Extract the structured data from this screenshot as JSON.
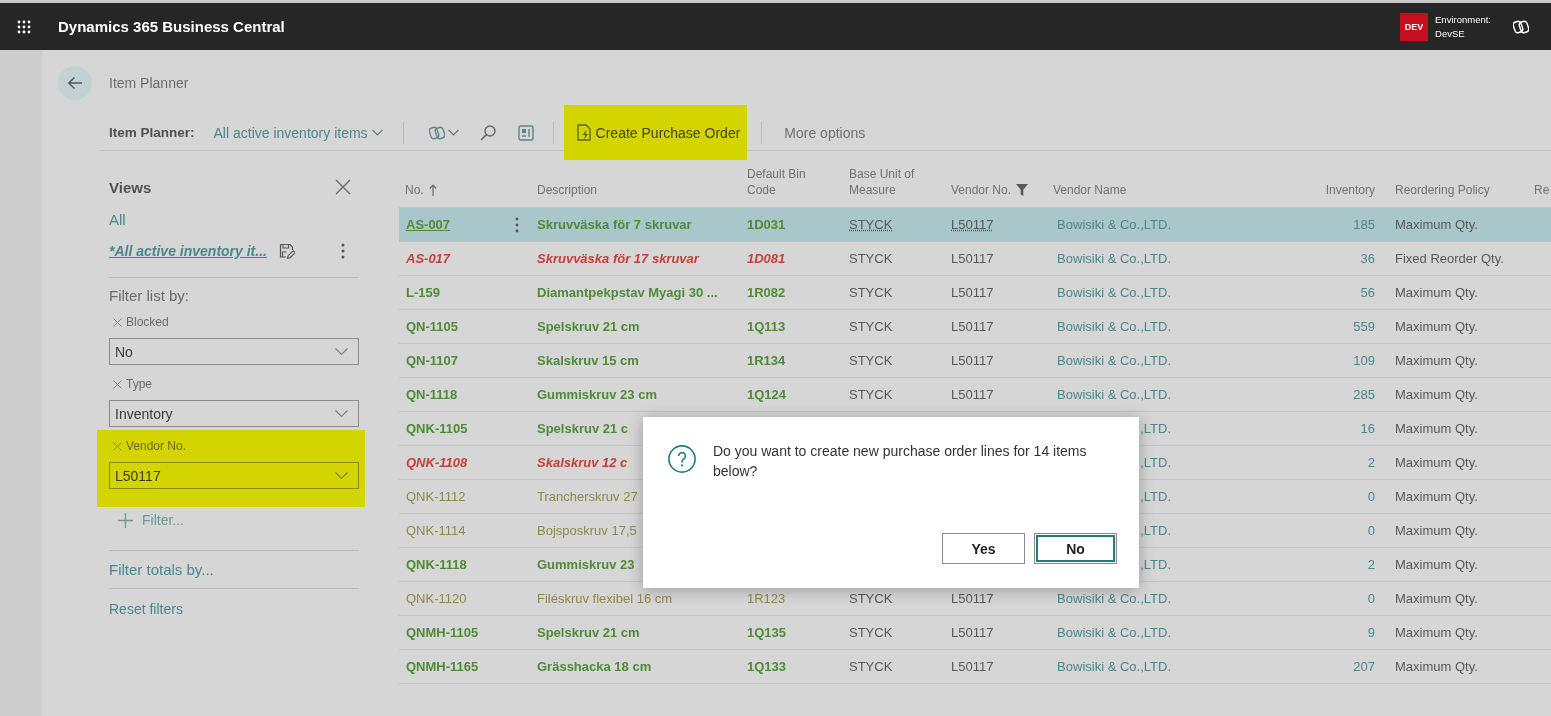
{
  "app_bar": {
    "title": "Dynamics 365 Business Central",
    "badge": "DEV",
    "environment_label": "Environment:",
    "environment_name": "DevSE"
  },
  "page": {
    "title": "Item Planner"
  },
  "toolbar": {
    "label": "Item Planner:",
    "view": "All active inventory items",
    "actions": [
      {
        "label": "Create Purchase Order",
        "highlighted": true
      }
    ],
    "more": "More options"
  },
  "filter_pane": {
    "title": "Views",
    "views": [
      {
        "label": "All",
        "selected": false
      },
      {
        "label": "*All active inventory it...",
        "selected": true
      }
    ],
    "filter_heading": "Filter list by:",
    "filters": [
      {
        "label": "Blocked",
        "value": "No",
        "highlighted": false
      },
      {
        "label": "Type",
        "value": "Inventory",
        "highlighted": false
      },
      {
        "label": "Vendor No.",
        "value": "L50117",
        "highlighted": true
      }
    ],
    "add_filter": "Filter...",
    "totals": "Filter totals by...",
    "reset": "Reset filters"
  },
  "table": {
    "columns": [
      {
        "label": "No.",
        "sorted": true,
        "filtered": false
      },
      {
        "label": "Description",
        "sorted": false,
        "filtered": false
      },
      {
        "label": "Default Bin Code",
        "sorted": false,
        "filtered": false
      },
      {
        "label": "Base Unit of Measure",
        "sorted": false,
        "filtered": false
      },
      {
        "label": "Vendor No.",
        "sorted": false,
        "filtered": true
      },
      {
        "label": "Vendor Name",
        "sorted": false,
        "filtered": false
      },
      {
        "label": "Inventory",
        "sorted": false,
        "filtered": false
      },
      {
        "label": "Reordering Policy",
        "sorted": false,
        "filtered": false
      },
      {
        "label": "Re"
      }
    ],
    "rows": [
      {
        "no": "AS-007",
        "description": "Skruvväska för 7 skruvar",
        "bin_code": "1D031",
        "unit": "STYCK",
        "vendor_no": "L50117",
        "vendor_name": "Bowisiki & Co.,LTD.",
        "inventory": "185",
        "policy": "Maximum Qty.",
        "kind": "favorable",
        "selected": true
      },
      {
        "no": "AS-017",
        "description": "Skruvväska för 17 skruvar",
        "bin_code": "1D081",
        "unit": "STYCK",
        "vendor_no": "L50117",
        "vendor_name": "Bowisiki & Co.,LTD.",
        "inventory": "36",
        "policy": "Fixed Reorder Qty.",
        "kind": "unfavorable",
        "selected": false
      },
      {
        "no": "L-159",
        "description": "Diamantpekpstav Myagi 30 ...",
        "bin_code": "1R082",
        "unit": "STYCK",
        "vendor_no": "L50117",
        "vendor_name": "Bowisiki & Co.,LTD.",
        "inventory": "56",
        "policy": "Maximum Qty.",
        "kind": "favorable",
        "selected": false
      },
      {
        "no": "QN-1105",
        "description": "Spelskruv 21 cm",
        "bin_code": "1Q113",
        "unit": "STYCK",
        "vendor_no": "L50117",
        "vendor_name": "Bowisiki & Co.,LTD.",
        "inventory": "559",
        "policy": "Maximum Qty.",
        "kind": "favorable",
        "selected": false
      },
      {
        "no": "QN-1107",
        "description": "Skalskruv 15 cm",
        "bin_code": "1R134",
        "unit": "STYCK",
        "vendor_no": "L50117",
        "vendor_name": "Bowisiki & Co.,LTD.",
        "inventory": "109",
        "policy": "Maximum Qty.",
        "kind": "favorable",
        "selected": false
      },
      {
        "no": "QN-1118",
        "description": "Gummiskruv 23 cm",
        "bin_code": "1Q124",
        "unit": "STYCK",
        "vendor_no": "L50117",
        "vendor_name": "Bowisiki & Co.,LTD.",
        "inventory": "285",
        "policy": "Maximum Qty.",
        "kind": "favorable",
        "selected": false
      },
      {
        "no": "QNK-1105",
        "description": "Spelskruv 21 c",
        "vendor_name": ",LTD.",
        "inventory": "16",
        "policy": "Maximum Qty.",
        "kind": "favorable",
        "selected": false
      },
      {
        "no": "QNK-1108",
        "description": "Skalskruv 12 c",
        "vendor_name": ",LTD.",
        "inventory": "2",
        "policy": "Maximum Qty.",
        "kind": "unfavorable",
        "selected": false
      },
      {
        "no": "QNK-1112",
        "description": "Trancherskruv 27",
        "vendor_name": ",LTD.",
        "inventory": "0",
        "policy": "Maximum Qty.",
        "kind": "ambiguous",
        "selected": false
      },
      {
        "no": "QNK-1114",
        "description": "Bojsposkruv 17,5",
        "vendor_name": ",LTD.",
        "inventory": "0",
        "policy": "Maximum Qty.",
        "kind": "ambiguous",
        "selected": false
      },
      {
        "no": "QNK-1118",
        "description": "Gummiskruv 23",
        "vendor_name": ",LTD.",
        "inventory": "2",
        "policy": "Maximum Qty.",
        "kind": "favorable",
        "selected": false
      },
      {
        "no": "QNK-1120",
        "description": "Filéskruv flexibel 16 cm",
        "bin_code": "1R123",
        "unit": "STYCK",
        "vendor_no": "L50117",
        "vendor_name": "Bowisiki & Co.,LTD.",
        "inventory": "0",
        "policy": "Maximum Qty.",
        "kind": "ambiguous",
        "selected": false
      },
      {
        "no": "QNMH-1105",
        "description": "Spelskruv 21 cm",
        "bin_code": "1Q135",
        "unit": "STYCK",
        "vendor_no": "L50117",
        "vendor_name": "Bowisiki & Co.,LTD.",
        "inventory": "9",
        "policy": "Maximum Qty.",
        "kind": "favorable",
        "selected": false
      },
      {
        "no": "QNMH-1165",
        "description": "Grässhacka 18 cm",
        "bin_code": "1Q133",
        "unit": "STYCK",
        "vendor_no": "L50117",
        "vendor_name": "Bowisiki & Co.,LTD.",
        "inventory": "207",
        "policy": "Maximum Qty.",
        "kind": "favorable",
        "selected": false
      }
    ]
  },
  "dialog": {
    "message": "Do you want to create new purchase order lines for 14 items below?",
    "buttons": [
      {
        "label": "Yes",
        "focused": false
      },
      {
        "label": "No",
        "focused": true
      }
    ]
  }
}
